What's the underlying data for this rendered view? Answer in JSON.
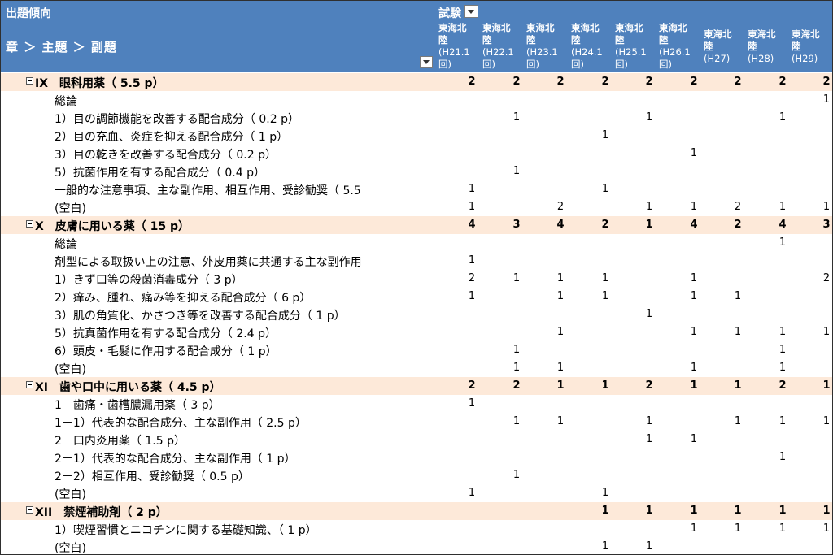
{
  "header": {
    "title": "出題傾向",
    "path": "章 ＞ 主題 ＞ 副題",
    "exam_label": "試験"
  },
  "columns": [
    {
      "line1": "東海北",
      "line2": "陸",
      "line3": "(H21.1",
      "line4": "回)"
    },
    {
      "line1": "東海北",
      "line2": "陸",
      "line3": "(H22.1",
      "line4": "回)"
    },
    {
      "line1": "東海北",
      "line2": "陸",
      "line3": "(H23.1",
      "line4": "回)"
    },
    {
      "line1": "東海北",
      "line2": "陸",
      "line3": "(H24.1",
      "line4": "回)"
    },
    {
      "line1": "東海北",
      "line2": "陸",
      "line3": "(H25.1",
      "line4": "回)"
    },
    {
      "line1": "東海北",
      "line2": "陸",
      "line3": "(H26.1",
      "line4": "回)"
    },
    {
      "line1": "東海北",
      "line2": "陸",
      "line3": "(H27)",
      "line4": ""
    },
    {
      "line1": "東海北",
      "line2": "陸",
      "line3": "(H28)",
      "line4": ""
    },
    {
      "line1": "東海北",
      "line2": "陸",
      "line3": "(H29)",
      "line4": ""
    }
  ],
  "rows": [
    {
      "type": "chap",
      "label": "IX　眼科用薬（ 5.5 p）",
      "values": [
        "2",
        "2",
        "2",
        "2",
        "2",
        "2",
        "2",
        "2",
        "2"
      ]
    },
    {
      "type": "item",
      "label": "総論",
      "values": [
        "",
        "",
        "",
        "",
        "",
        "",
        "",
        "",
        "1"
      ]
    },
    {
      "type": "item",
      "label": "1）目の調節機能を改善する配合成分（ 0.2 p）",
      "values": [
        "",
        "1",
        "",
        "",
        "1",
        "",
        "",
        "1",
        ""
      ]
    },
    {
      "type": "item",
      "label": "2）目の充血、炎症を抑える配合成分（ 1 p）",
      "values": [
        "",
        "",
        "",
        "1",
        "",
        "",
        "",
        "",
        ""
      ]
    },
    {
      "type": "item",
      "label": "3）目の乾きを改善する配合成分（ 0.2 p）",
      "values": [
        "",
        "",
        "",
        "",
        "",
        "1",
        "",
        "",
        ""
      ]
    },
    {
      "type": "item",
      "label": "5）抗菌作用を有する配合成分（ 0.4 p）",
      "values": [
        "",
        "1",
        "",
        "",
        "",
        "",
        "",
        "",
        ""
      ]
    },
    {
      "type": "item",
      "label": "一般的な注意事項、主な副作用、相互作用、受診勧奨（ 5.5",
      "values": [
        "1",
        "",
        "",
        "1",
        "",
        "",
        "",
        "",
        ""
      ]
    },
    {
      "type": "item",
      "label": "(空白)",
      "values": [
        "1",
        "",
        "2",
        "",
        "1",
        "1",
        "2",
        "1",
        "1"
      ]
    },
    {
      "type": "chap",
      "label": "X　皮膚に用いる薬（ 15 p）",
      "values": [
        "4",
        "3",
        "4",
        "2",
        "1",
        "4",
        "2",
        "4",
        "3"
      ]
    },
    {
      "type": "item",
      "label": "総論",
      "values": [
        "",
        "",
        "",
        "",
        "",
        "",
        "",
        "1",
        ""
      ]
    },
    {
      "type": "item",
      "label": "剤型による取扱い上の注意、外皮用薬に共通する主な副作用",
      "values": [
        "1",
        "",
        "",
        "",
        "",
        "",
        "",
        "",
        ""
      ]
    },
    {
      "type": "item",
      "label": "1）きず口等の殺菌消毒成分（ 3 p）",
      "values": [
        "2",
        "1",
        "1",
        "1",
        "",
        "1",
        "",
        "",
        "2"
      ]
    },
    {
      "type": "item",
      "label": "2）痒み、腫れ、痛み等を抑える配合成分（ 6 p）",
      "values": [
        "1",
        "",
        "1",
        "1",
        "",
        "1",
        "1",
        "",
        ""
      ]
    },
    {
      "type": "item",
      "label": "3）肌の角質化、かさつき等を改善する配合成分（ 1 p）",
      "values": [
        "",
        "",
        "",
        "",
        "1",
        "",
        "",
        "",
        ""
      ]
    },
    {
      "type": "item",
      "label": "5）抗真菌作用を有する配合成分（ 2.4 p）",
      "values": [
        "",
        "",
        "1",
        "",
        "",
        "1",
        "1",
        "1",
        "1"
      ]
    },
    {
      "type": "item",
      "label": "6）頭皮・毛髪に作用する配合成分（ 1 p）",
      "values": [
        "",
        "1",
        "",
        "",
        "",
        "",
        "",
        "1",
        ""
      ]
    },
    {
      "type": "item",
      "label": "(空白)",
      "values": [
        "",
        "1",
        "1",
        "",
        "",
        "1",
        "",
        "1",
        ""
      ]
    },
    {
      "type": "chap",
      "label": "XI　歯や口中に用いる薬（ 4.5 p）",
      "values": [
        "2",
        "2",
        "1",
        "1",
        "2",
        "1",
        "1",
        "2",
        "1"
      ]
    },
    {
      "type": "item",
      "label": "1　歯痛・歯槽膿漏用薬（ 3 p）",
      "values": [
        "1",
        "",
        "",
        "",
        "",
        "",
        "",
        "",
        ""
      ]
    },
    {
      "type": "item",
      "label": "1－1）代表的な配合成分、主な副作用（ 2.5 p）",
      "values": [
        "",
        "1",
        "1",
        "",
        "1",
        "",
        "1",
        "1",
        "1"
      ]
    },
    {
      "type": "item",
      "label": "2　口内炎用薬（ 1.5 p）",
      "values": [
        "",
        "",
        "",
        "",
        "1",
        "1",
        "",
        "",
        ""
      ]
    },
    {
      "type": "item",
      "label": "2－1）代表的な配合成分、主な副作用（ 1 p）",
      "values": [
        "",
        "",
        "",
        "",
        "",
        "",
        "",
        "1",
        ""
      ]
    },
    {
      "type": "item",
      "label": "2－2）相互作用、受診勧奨（ 0.5 p）",
      "values": [
        "",
        "1",
        "",
        "",
        "",
        "",
        "",
        "",
        ""
      ]
    },
    {
      "type": "item",
      "label": "(空白)",
      "values": [
        "1",
        "",
        "",
        "1",
        "",
        "",
        "",
        "",
        ""
      ]
    },
    {
      "type": "chap",
      "label": "XII　禁煙補助剤（ 2 p）",
      "values": [
        "",
        "",
        "",
        "1",
        "1",
        "1",
        "1",
        "1",
        "1"
      ]
    },
    {
      "type": "item",
      "label": "1）喫煙習慣とニコチンに関する基礎知識、（ 1 p）",
      "values": [
        "",
        "",
        "",
        "",
        "",
        "1",
        "1",
        "1",
        "1"
      ]
    },
    {
      "type": "item",
      "label": "(空白)",
      "values": [
        "",
        "",
        "",
        "1",
        "1",
        "",
        "",
        "",
        ""
      ]
    }
  ]
}
